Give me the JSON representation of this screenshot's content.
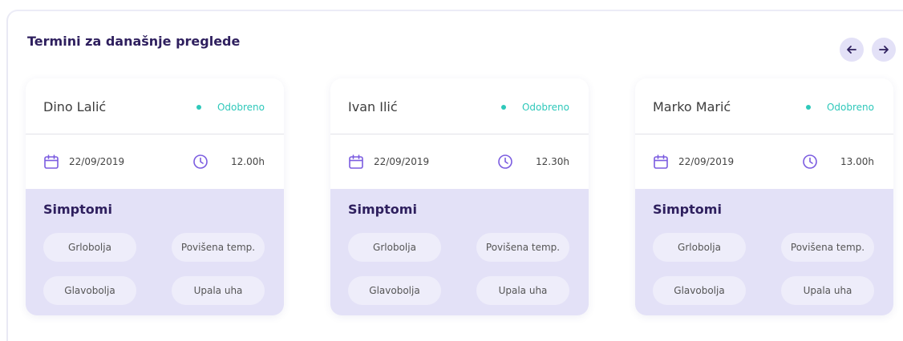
{
  "panel": {
    "title": "Termini za današnje preglede"
  },
  "colors": {
    "accent": "#2e1f5e",
    "status": "#2ec8ba",
    "symptom_bg": "#e3e1f7"
  },
  "icons": {
    "prev": "arrow-left-icon",
    "next": "arrow-right-icon",
    "date": "calendar-icon",
    "time": "clock-icon"
  },
  "cards": [
    {
      "name": "Dino Lalić",
      "status": "Odobreno",
      "date": "22/09/2019",
      "time": "12.00h",
      "symptoms_title": "Simptomi",
      "symptoms": [
        "Grlobolja",
        "Povišena temp.",
        "Glavobolja",
        "Upala uha"
      ]
    },
    {
      "name": "Ivan Ilić",
      "status": "Odobreno",
      "date": "22/09/2019",
      "time": "12.30h",
      "symptoms_title": "Simptomi",
      "symptoms": [
        "Grlobolja",
        "Povišena temp.",
        "Glavobolja",
        "Upala uha"
      ]
    },
    {
      "name": "Marko Marić",
      "status": "Odobreno",
      "date": "22/09/2019",
      "time": "13.00h",
      "symptoms_title": "Simptomi",
      "symptoms": [
        "Grlobolja",
        "Povišena temp.",
        "Glavobolja",
        "Upala uha"
      ]
    }
  ]
}
